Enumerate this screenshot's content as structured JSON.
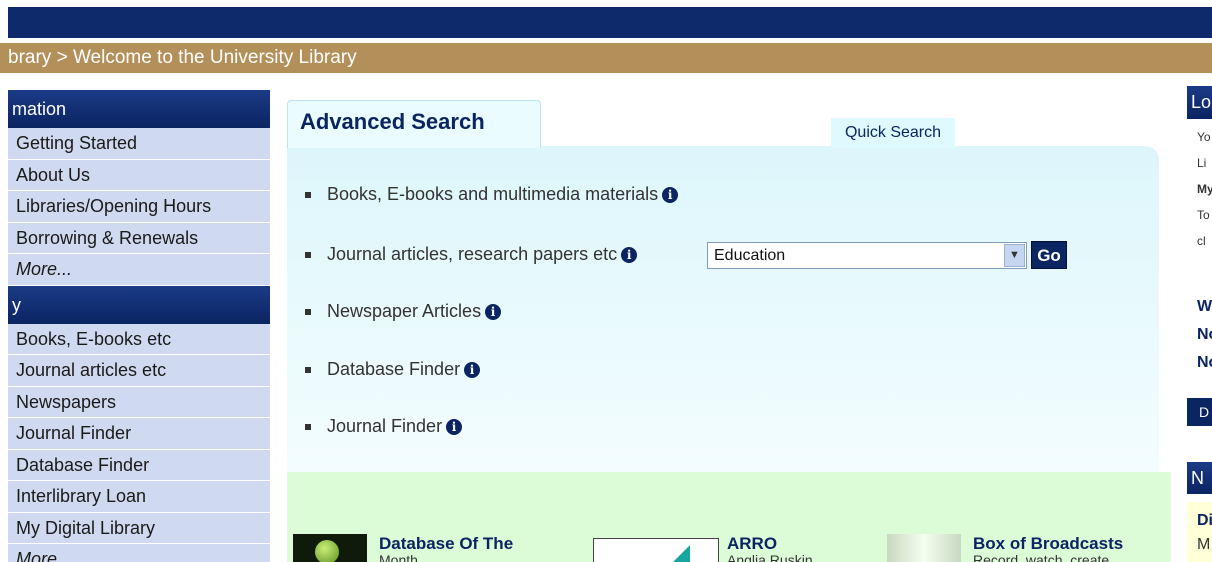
{
  "breadcrumb": "brary > Welcome to the University Library",
  "sidebar": {
    "section1_heading": "mation",
    "section1_items": [
      "Getting Started",
      "About Us",
      "Libraries/Opening Hours",
      "Borrowing & Renewals",
      "More..."
    ],
    "section2_heading": "y",
    "section2_items": [
      "Books, E-books etc",
      "Journal articles etc",
      "Newspapers",
      "Journal Finder",
      "Database Finder",
      "Interlibrary Loan",
      "My Digital Library",
      "More..."
    ]
  },
  "search": {
    "tab_advanced": "Advanced Search",
    "tab_quick": "Quick Search",
    "options": [
      "Books, E-books and multimedia materials",
      "Journal articles, research papers etc",
      "Newspaper Articles",
      "Database Finder",
      "Journal Finder"
    ],
    "subject_select_value": "Education",
    "go_label": "Go",
    "info_glyph": "i"
  },
  "features": {
    "items": [
      {
        "title": "Database Of The",
        "subtitle": "Month"
      },
      {
        "title": "ARRO",
        "subtitle": "Anglia Ruskin"
      },
      {
        "title": "Box of Broadcasts",
        "subtitle": "Record, watch, create"
      }
    ]
  },
  "right_panel": {
    "heading1": "Lo",
    "lines": [
      "Yo",
      "Li",
      "My",
      "To",
      "cl"
    ],
    "bold_lines": [
      "W",
      "No",
      "No"
    ],
    "button": "D",
    "heading2": "N",
    "box_lines": [
      "Di",
      "M"
    ]
  },
  "icons": [
    "info-icon",
    "dropdown-arrow-icon",
    "bullet-square-icon"
  ],
  "colors": {
    "nav_dark": "#0f2a6b",
    "breadcrumb": "#b3905a",
    "sidebar_item": "#cfdaf0",
    "panel_bg": "#eafcff",
    "feature_bg": "#dcfcd8"
  }
}
